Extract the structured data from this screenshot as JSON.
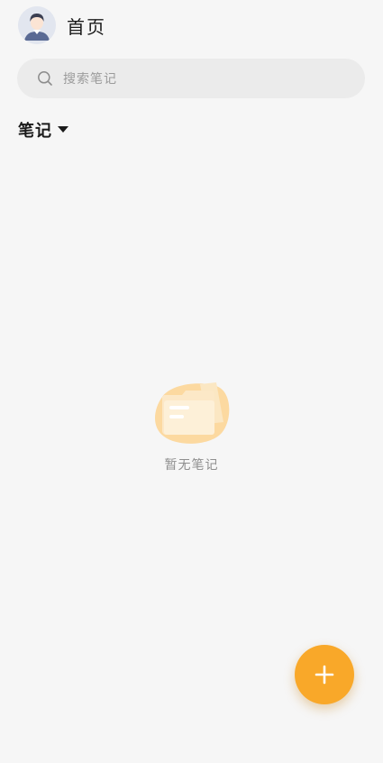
{
  "header": {
    "title": "首页",
    "avatar_icon": "user-avatar-icon"
  },
  "search": {
    "placeholder": "搜索笔记",
    "icon": "search-icon"
  },
  "filter": {
    "label": "笔记",
    "icon": "caret-down-icon"
  },
  "empty_state": {
    "text": "暂无笔记",
    "icon": "empty-folder-icon"
  },
  "fab": {
    "icon": "plus-icon"
  },
  "colors": {
    "accent": "#f9a829",
    "background": "#f6f6f6",
    "search_bg": "#ebebeb"
  }
}
